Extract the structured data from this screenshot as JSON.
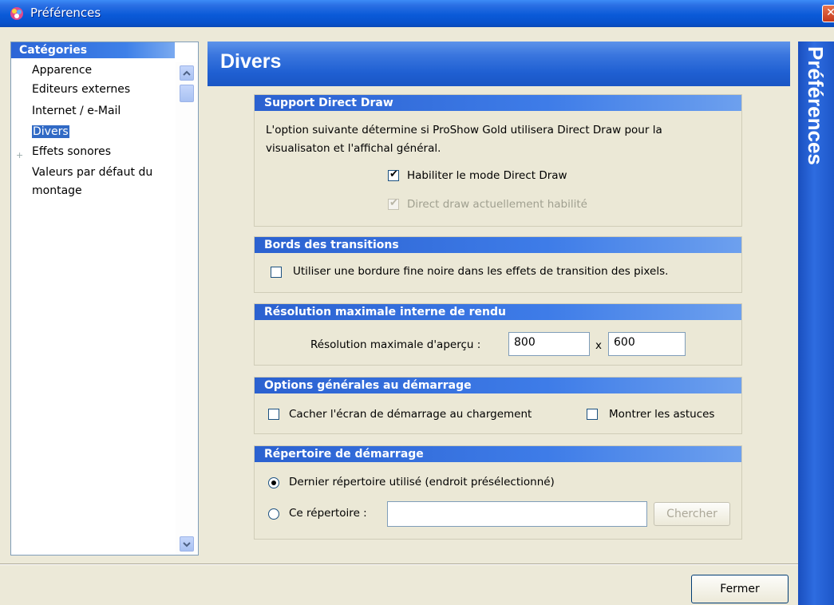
{
  "window": {
    "title": "Préférences",
    "close_symbol": "✕"
  },
  "sidebar": {
    "header": "Catégories",
    "items": [
      {
        "label": "Apparence"
      },
      {
        "label": "Editeurs externes"
      },
      {
        "label": "Internet / e-Mail"
      },
      {
        "label": "Divers",
        "selected": true
      },
      {
        "label": "Effets sonores"
      },
      {
        "label": "Valeurs par défaut du"
      },
      {
        "label": "montage"
      }
    ],
    "expand_symbol": "+"
  },
  "main": {
    "title": "Divers",
    "side_label": "Préférences"
  },
  "groups": {
    "direct_draw": {
      "header": "Support Direct Draw",
      "description_line1": "L'option suivante détermine si ProShow Gold utilisera Direct Draw pour la",
      "description_line2": "visualisaton et l'affichal général.",
      "enable_label": "Habiliter le mode Direct Draw",
      "enable_checked": true,
      "current_label": "Direct draw actuellement habilité",
      "current_checked": true
    },
    "transitions": {
      "header": "Bords des transitions",
      "border_label": "Utiliser une bordure fine noire dans les effets de transition des pixels.",
      "border_checked": false
    },
    "resolution": {
      "header": "Résolution maximale interne de rendu",
      "label": "Résolution maximale d'aperçu :",
      "width": "800",
      "separator": "x",
      "height": "600"
    },
    "startup": {
      "header": "Options générales au démarrage",
      "hide_splash_label": "Cacher l'écran de démarrage au chargement",
      "hide_splash_checked": false,
      "tips_label": "Montrer les astuces",
      "tips_checked": false
    },
    "start_dir": {
      "header": "Répertoire de démarrage",
      "last_dir_label": "Dernier répertoire utilisé (endroit présélectionné)",
      "this_dir_label": "Ce répertoire :",
      "selected_option": "last_dir",
      "path_value": "",
      "browse_label": "Chercher"
    }
  },
  "footer": {
    "close_label": "Fermer"
  },
  "colors": {
    "accent": "#2b61d0",
    "selection": "#316ac5",
    "window_bg": "#ece9d8"
  }
}
